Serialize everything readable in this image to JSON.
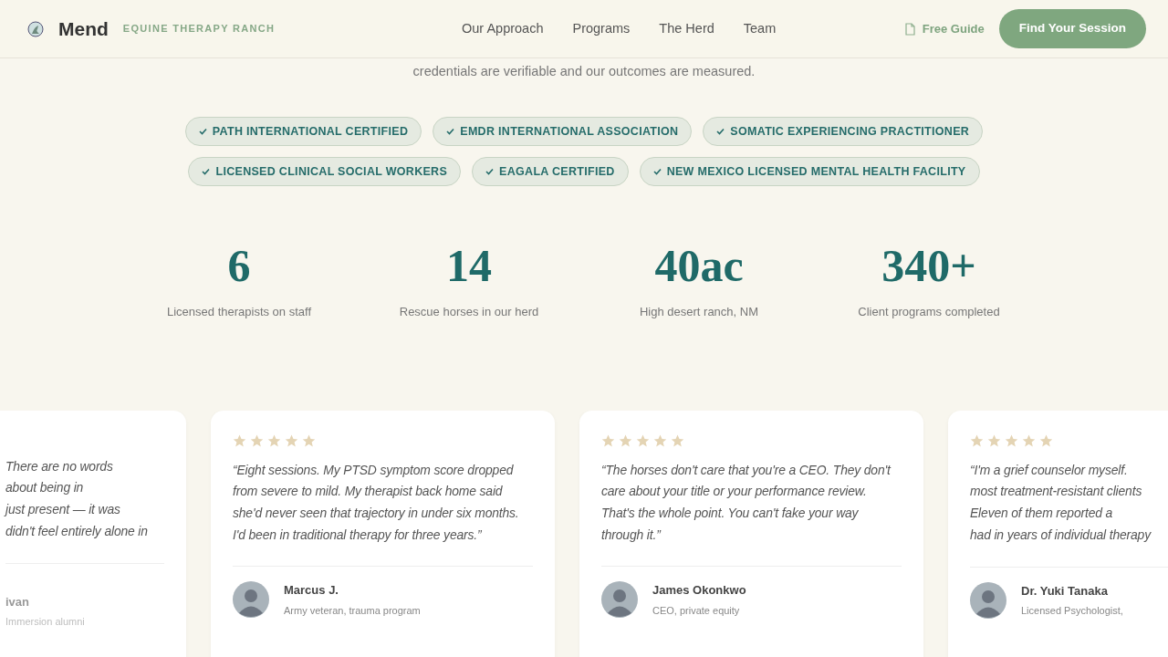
{
  "header": {
    "brand": "Mend",
    "tagline": "EQUINE THERAPY RANCH",
    "nav": [
      {
        "label": "Our Approach"
      },
      {
        "label": "Programs"
      },
      {
        "label": "The Herd"
      },
      {
        "label": "Team"
      }
    ],
    "guide_link": "Free Guide",
    "cta": "Find Your Session"
  },
  "intro": "credentials are verifiable and our outcomes are measured.",
  "credentials": [
    {
      "label": "PATH INTERNATIONAL CERTIFIED"
    },
    {
      "label": "EMDR INTERNATIONAL ASSOCIATION"
    },
    {
      "label": "SOMATIC EXPERIENCING PRACTITIONER"
    },
    {
      "label": "LICENSED CLINICAL SOCIAL WORKERS"
    },
    {
      "label": "EAGALA CERTIFIED"
    },
    {
      "label": "NEW MEXICO LICENSED MENTAL HEALTH FACILITY"
    }
  ],
  "stats": [
    {
      "value": "6",
      "label": "Licensed therapists on staff"
    },
    {
      "value": "14",
      "label": "Rescue horses in our herd"
    },
    {
      "value": "40ac",
      "label": "High desert ranch, NM"
    },
    {
      "value": "340+",
      "label": "Client programs completed"
    }
  ],
  "testimonials": [
    {
      "kind": "left_edge",
      "quote_lines": [
        "There are no words",
        "about being in",
        "just present — it was",
        "didn't feel entirely alone in"
      ],
      "name": "ivan",
      "role": "Immersion alumni"
    },
    {
      "kind": "full",
      "stars": 5,
      "quote": "“Eight sessions. My PTSD symptom score dropped from severe to mild. My therapist back home said she'd never seen that trajectory in under six months. I'd been in traditional therapy for three years.”",
      "name": "Marcus J.",
      "role": "Army veteran, trauma program"
    },
    {
      "kind": "full",
      "stars": 5,
      "quote": "“The horses don't care that you're a CEO. They don't care about your title or your performance review. That's the whole point. You can't fake your way through it.”",
      "name": "James Okonkwo",
      "role": "CEO, private equity"
    },
    {
      "kind": "right_edge",
      "stars": 5,
      "quote_lines": [
        "“I'm a grief counselor myself.",
        "most treatment-resistant clients",
        "Eleven of them reported a",
        "had in years of individual therapy"
      ],
      "name": "Dr. Yuki Tanaka",
      "role": "Licensed Psychologist,"
    }
  ]
}
